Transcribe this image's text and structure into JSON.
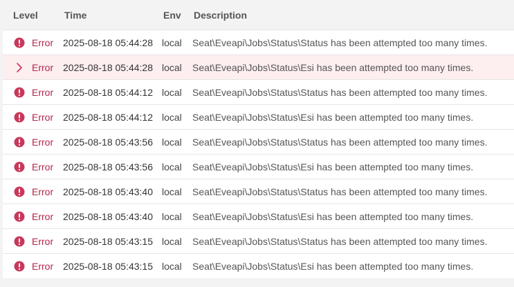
{
  "header": {
    "level": "Level",
    "time": "Time",
    "env": "Env",
    "description": "Description"
  },
  "colors": {
    "error": "#c8385a",
    "selected_row": "#fdeef0"
  },
  "rows": [
    {
      "icon": "error-icon",
      "level": "Error",
      "time": "2025-08-18 05:44:28",
      "env": "local",
      "description": "Seat\\Eveapi\\Jobs\\Status\\Status has been attempted too many times.",
      "selected": false
    },
    {
      "icon": "chevron-right-icon",
      "level": "Error",
      "time": "2025-08-18 05:44:28",
      "env": "local",
      "description": "Seat\\Eveapi\\Jobs\\Status\\Esi has been attempted too many times.",
      "selected": true
    },
    {
      "icon": "error-icon",
      "level": "Error",
      "time": "2025-08-18 05:44:12",
      "env": "local",
      "description": "Seat\\Eveapi\\Jobs\\Status\\Status has been attempted too many times.",
      "selected": false
    },
    {
      "icon": "error-icon",
      "level": "Error",
      "time": "2025-08-18 05:44:12",
      "env": "local",
      "description": "Seat\\Eveapi\\Jobs\\Status\\Esi has been attempted too many times.",
      "selected": false
    },
    {
      "icon": "error-icon",
      "level": "Error",
      "time": "2025-08-18 05:43:56",
      "env": "local",
      "description": "Seat\\Eveapi\\Jobs\\Status\\Status has been attempted too many times.",
      "selected": false
    },
    {
      "icon": "error-icon",
      "level": "Error",
      "time": "2025-08-18 05:43:56",
      "env": "local",
      "description": "Seat\\Eveapi\\Jobs\\Status\\Esi has been attempted too many times.",
      "selected": false
    },
    {
      "icon": "error-icon",
      "level": "Error",
      "time": "2025-08-18 05:43:40",
      "env": "local",
      "description": "Seat\\Eveapi\\Jobs\\Status\\Status has been attempted too many times.",
      "selected": false
    },
    {
      "icon": "error-icon",
      "level": "Error",
      "time": "2025-08-18 05:43:40",
      "env": "local",
      "description": "Seat\\Eveapi\\Jobs\\Status\\Esi has been attempted too many times.",
      "selected": false
    },
    {
      "icon": "error-icon",
      "level": "Error",
      "time": "2025-08-18 05:43:15",
      "env": "local",
      "description": "Seat\\Eveapi\\Jobs\\Status\\Status has been attempted too many times.",
      "selected": false
    },
    {
      "icon": "error-icon",
      "level": "Error",
      "time": "2025-08-18 05:43:15",
      "env": "local",
      "description": "Seat\\Eveapi\\Jobs\\Status\\Esi has been attempted too many times.",
      "selected": false
    }
  ]
}
